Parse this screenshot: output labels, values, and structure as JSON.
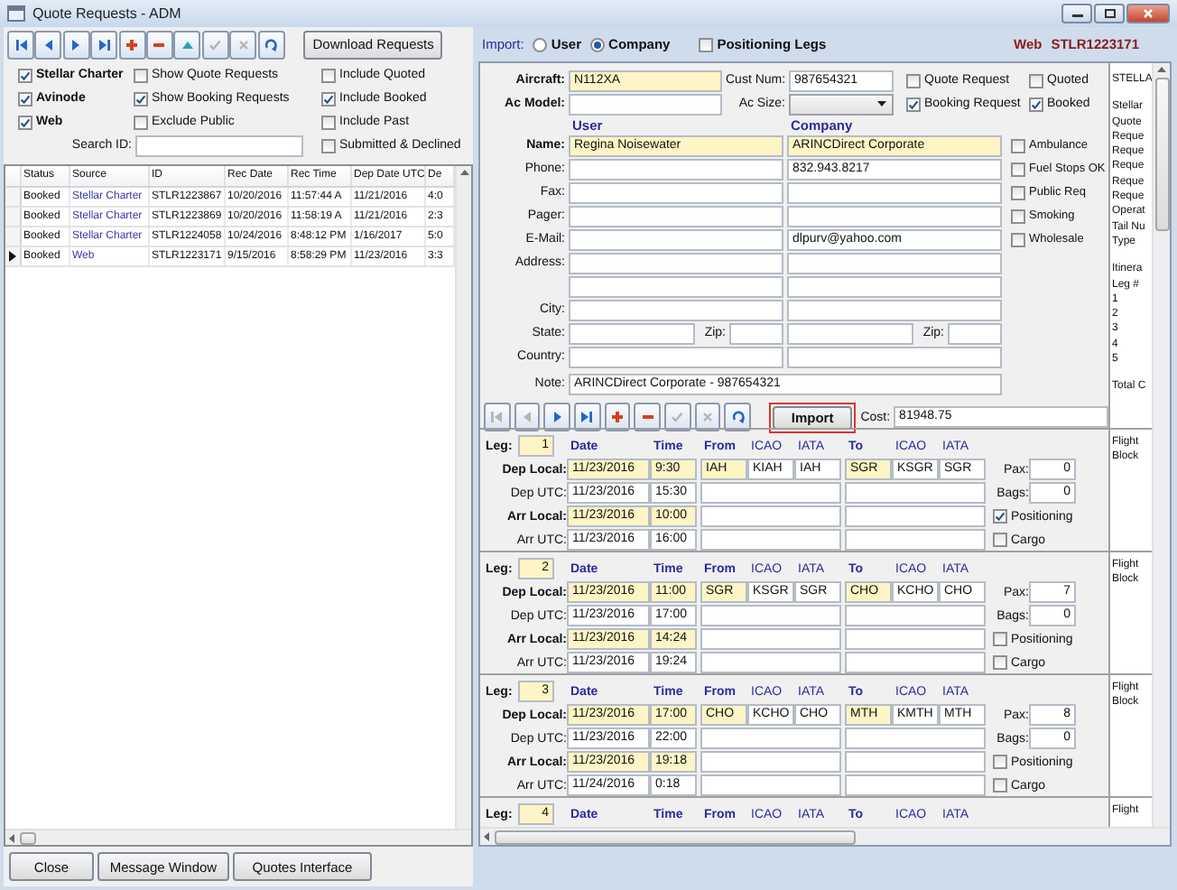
{
  "window": {
    "title": "Quote Requests - ADM"
  },
  "list_toolbar": [
    {
      "kind": "first",
      "disabled": false
    },
    {
      "kind": "prev",
      "disabled": false
    },
    {
      "kind": "next",
      "disabled": false
    },
    {
      "kind": "last",
      "disabled": false
    },
    {
      "kind": "add",
      "disabled": false
    },
    {
      "kind": "remove",
      "disabled": false
    },
    {
      "kind": "up",
      "disabled": false
    },
    {
      "kind": "accept",
      "disabled": true
    },
    {
      "kind": "cancel",
      "disabled": true
    },
    {
      "kind": "refresh",
      "disabled": false
    }
  ],
  "download_button": "Download Requests",
  "filter_columns": [
    [
      {
        "kind": "source",
        "label": "Stellar Charter",
        "checked": true
      },
      {
        "kind": "source",
        "label": "Avinode",
        "checked": true
      },
      {
        "kind": "source",
        "label": "Web",
        "checked": true
      }
    ],
    [
      {
        "kind": "option",
        "label": "Show Quote Requests",
        "checked": false
      },
      {
        "kind": "option",
        "label": "Show Booking Requests",
        "checked": true
      },
      {
        "kind": "option",
        "label": "Exclude Public",
        "checked": false
      }
    ],
    [
      {
        "kind": "option",
        "label": "Include Quoted",
        "checked": false
      },
      {
        "kind": "option",
        "label": "Include Booked",
        "checked": true
      },
      {
        "kind": "option",
        "label": "Include Past",
        "checked": false
      },
      {
        "kind": "option",
        "label": "Submitted & Declined",
        "checked": false
      }
    ]
  ],
  "search": {
    "label": "Search ID:"
  },
  "requests_table": {
    "columns": [
      "Status",
      "Source",
      "ID",
      "Rec Date",
      "Rec Time",
      "Dep Date UTC",
      "De"
    ],
    "rows": [
      {
        "selected": false,
        "cells": [
          "Booked",
          "Stellar Charter",
          "STLR1223867",
          "10/20/2016",
          "11:57:44 A",
          "11/21/2016",
          "4:0"
        ]
      },
      {
        "selected": false,
        "cells": [
          "Booked",
          "Stellar Charter",
          "STLR1223869",
          "10/20/2016",
          "11:58:19 A",
          "11/21/2016",
          "2:3"
        ]
      },
      {
        "selected": false,
        "cells": [
          "Booked",
          "Stellar Charter",
          "STLR1224058",
          "10/24/2016",
          "8:48:12 PM",
          "1/16/2017",
          "5:0"
        ]
      },
      {
        "selected": true,
        "cells": [
          "Booked",
          "Web",
          "STLR1223171",
          "9/15/2016",
          "8:58:29 PM",
          "11/23/2016",
          "3:3"
        ]
      }
    ]
  },
  "bottom_buttons": [
    "Close",
    "Message Window",
    "Quotes Interface"
  ],
  "import_mode": {
    "label": "Import:",
    "options": [
      {
        "label": "User",
        "selected": false
      },
      {
        "label": "Company",
        "selected": true
      }
    ]
  },
  "positioning_legs": {
    "label": "Positioning Legs",
    "checked": false
  },
  "record": {
    "source": "Web",
    "id": "STLR1223171"
  },
  "aircraft": {
    "label": "Aircraft:",
    "value": "N112XA"
  },
  "cust_num": {
    "label": "Cust Num:",
    "value": "987654321"
  },
  "ac_model": {
    "label": "Ac Model:"
  },
  "ac_size": {
    "label": "Ac Size:"
  },
  "status_flags": [
    {
      "label": "Quote Request",
      "checked": false
    },
    {
      "label": "Quoted",
      "checked": false
    },
    {
      "label": "Booking Request",
      "checked": true
    },
    {
      "label": "Booked",
      "checked": true
    }
  ],
  "contact": {
    "columns": [
      "User",
      "Company"
    ],
    "rows": [
      {
        "kind": "required",
        "label": "Name:",
        "user": "Regina Noisewater",
        "company": "ARINCDirect Corporate"
      },
      {
        "kind": "plain",
        "label": "Phone:",
        "company": "832.943.8217"
      },
      {
        "kind": "plain",
        "label": "Fax:"
      },
      {
        "kind": "plain",
        "label": "Pager:"
      },
      {
        "kind": "plain",
        "label": "E-Mail:",
        "company": "dlpurv@yahoo.com"
      },
      {
        "kind": "plain",
        "label": "Address:"
      },
      {
        "kind": "plain"
      },
      {
        "kind": "plain",
        "label": "City:"
      },
      {
        "kind": "state",
        "label": "State:",
        "zip_labels": [
          "Zip:",
          "Zip:"
        ]
      },
      {
        "kind": "plain",
        "label": "Country:"
      }
    ]
  },
  "trip_options": [
    {
      "label": "Ambulance",
      "checked": false
    },
    {
      "label": "Fuel Stops OK",
      "checked": false
    },
    {
      "label": "Public Req",
      "checked": false
    },
    {
      "label": "Smoking",
      "checked": false
    },
    {
      "label": "Wholesale",
      "checked": false
    }
  ],
  "note": {
    "label": "Note:",
    "value": "ARINCDirect Corporate - 987654321"
  },
  "detail_toolbar": [
    {
      "kind": "first",
      "disabled": true
    },
    {
      "kind": "prev",
      "disabled": true
    },
    {
      "kind": "next",
      "disabled": false
    },
    {
      "kind": "last",
      "disabled": false
    },
    {
      "kind": "add",
      "disabled": false
    },
    {
      "kind": "remove",
      "disabled": false
    },
    {
      "kind": "accept",
      "disabled": true
    },
    {
      "kind": "cancel",
      "disabled": true
    },
    {
      "kind": "refresh",
      "disabled": false
    }
  ],
  "import_button": "Import",
  "cost": {
    "label": "Cost:",
    "value": "81948.75"
  },
  "summary_panel": [
    [
      "STELLA"
    ],
    [
      "Stellar",
      "Quote",
      "Reque",
      "Reque",
      "Reque",
      "Reque",
      "Reque",
      "Operat",
      "Tail Nu",
      "Type"
    ],
    [
      "Itinera",
      "Leg #",
      "1",
      "2",
      "3",
      "4",
      "5"
    ],
    [
      "Total C"
    ]
  ],
  "legs": [
    {
      "label": "Leg:",
      "number": "1",
      "headers": [
        "Date",
        "Time",
        "From",
        "ICAO",
        "IATA",
        "To",
        "ICAO",
        "IATA"
      ],
      "rows": [
        {
          "kind": "local",
          "label": "Dep Local:",
          "date": "11/23/2016",
          "time": "9:30",
          "from": [
            "IAH",
            "KIAH",
            "IAH"
          ],
          "to": [
            "SGR",
            "KSGR",
            "SGR"
          ]
        },
        {
          "kind": "utc",
          "label": "Dep UTC:",
          "date": "11/23/2016",
          "time": "15:30"
        },
        {
          "kind": "local",
          "label": "Arr Local:",
          "date": "11/23/2016",
          "time": "10:00"
        },
        {
          "kind": "utc",
          "label": "Arr UTC:",
          "date": "11/23/2016",
          "time": "16:00"
        }
      ],
      "extras": [
        {
          "kind": "field",
          "label": "Pax:",
          "value": "0"
        },
        {
          "kind": "field",
          "label": "Bags:",
          "value": "0"
        },
        {
          "kind": "check",
          "label": "Positioning",
          "checked": true
        },
        {
          "kind": "check",
          "label": "Cargo",
          "checked": false
        }
      ],
      "side": [
        "Flight",
        "Block"
      ]
    },
    {
      "label": "Leg:",
      "number": "2",
      "headers": [
        "Date",
        "Time",
        "From",
        "ICAO",
        "IATA",
        "To",
        "ICAO",
        "IATA"
      ],
      "rows": [
        {
          "kind": "local",
          "label": "Dep Local:",
          "date": "11/23/2016",
          "time": "11:00",
          "from": [
            "SGR",
            "KSGR",
            "SGR"
          ],
          "to": [
            "CHO",
            "KCHO",
            "CHO"
          ]
        },
        {
          "kind": "utc",
          "label": "Dep UTC:",
          "date": "11/23/2016",
          "time": "17:00"
        },
        {
          "kind": "local",
          "label": "Arr Local:",
          "date": "11/23/2016",
          "time": "14:24"
        },
        {
          "kind": "utc",
          "label": "Arr UTC:",
          "date": "11/23/2016",
          "time": "19:24"
        }
      ],
      "extras": [
        {
          "kind": "field",
          "label": "Pax:",
          "value": "7"
        },
        {
          "kind": "field",
          "label": "Bags:",
          "value": "0"
        },
        {
          "kind": "check",
          "label": "Positioning",
          "checked": false
        },
        {
          "kind": "check",
          "label": "Cargo",
          "checked": false
        }
      ],
      "side": [
        "Flight",
        "Block"
      ]
    },
    {
      "label": "Leg:",
      "number": "3",
      "headers": [
        "Date",
        "Time",
        "From",
        "ICAO",
        "IATA",
        "To",
        "ICAO",
        "IATA"
      ],
      "rows": [
        {
          "kind": "local",
          "label": "Dep Local:",
          "date": "11/23/2016",
          "time": "17:00",
          "from": [
            "CHO",
            "KCHO",
            "CHO"
          ],
          "to": [
            "MTH",
            "KMTH",
            "MTH"
          ]
        },
        {
          "kind": "utc",
          "label": "Dep UTC:",
          "date": "11/23/2016",
          "time": "22:00"
        },
        {
          "kind": "local",
          "label": "Arr Local:",
          "date": "11/23/2016",
          "time": "19:18"
        },
        {
          "kind": "utc",
          "label": "Arr UTC:",
          "date": "11/24/2016",
          "time": "0:18"
        }
      ],
      "extras": [
        {
          "kind": "field",
          "label": "Pax:",
          "value": "8"
        },
        {
          "kind": "field",
          "label": "Bags:",
          "value": "0"
        },
        {
          "kind": "check",
          "label": "Positioning",
          "checked": false
        },
        {
          "kind": "check",
          "label": "Cargo",
          "checked": false
        }
      ],
      "side": [
        "Flight",
        "Block"
      ]
    },
    {
      "label": "Leg:",
      "number": "4",
      "headers": [
        "Date",
        "Time",
        "From",
        "ICAO",
        "IATA",
        "To",
        "ICAO",
        "IATA"
      ],
      "side": [
        "Flight"
      ]
    }
  ]
}
